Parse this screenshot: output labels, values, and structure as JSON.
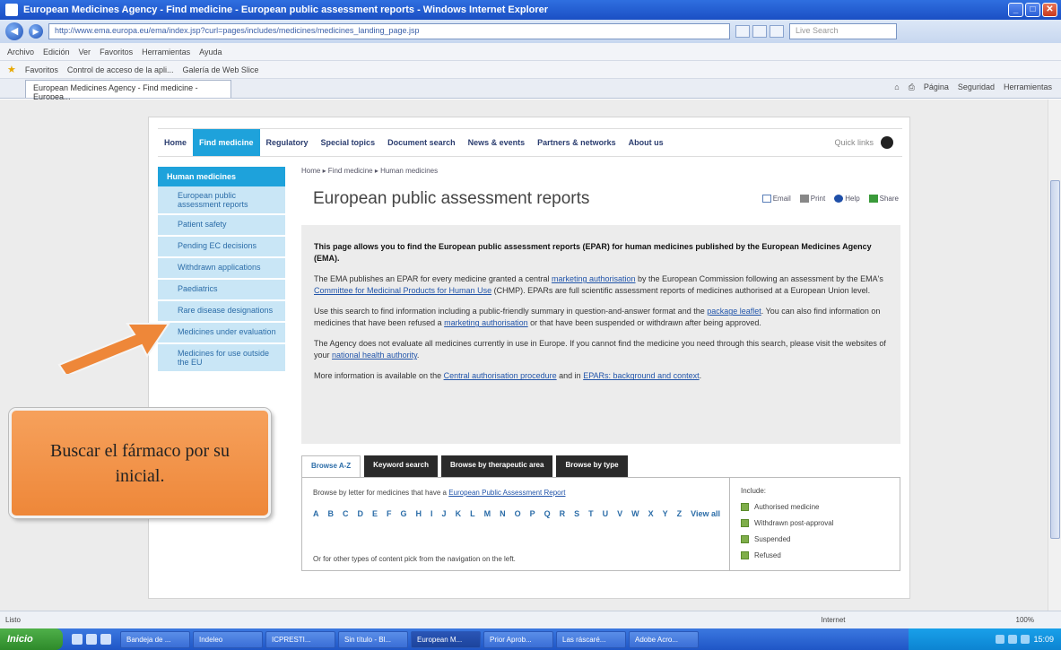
{
  "browser": {
    "title": "European Medicines Agency - Find medicine - European public assessment reports - Windows Internet Explorer",
    "url": "http://www.ema.europa.eu/ema/index.jsp?curl=pages/includes/medicines/medicines_landing_page.jsp",
    "search_placeholder": "Live Search",
    "menu": [
      "Archivo",
      "Edición",
      "Ver",
      "Favoritos",
      "Herramientas",
      "Ayuda"
    ],
    "favorites": [
      "Favoritos",
      "Control de acceso de la apli...",
      "Galería de Web Slice"
    ],
    "tab_label": "European Medicines Agency - Find medicine - Europea...",
    "cmd_tools": [
      "Página",
      "Seguridad",
      "Herramientas"
    ]
  },
  "site": {
    "nav": [
      "Home",
      "Find medicine",
      "Regulatory",
      "Special topics",
      "Document search",
      "News & events",
      "Partners & networks",
      "About us"
    ],
    "quick_links": "Quick links",
    "left_nav": {
      "header": "Human medicines",
      "items": [
        "European public assessment reports",
        "Patient safety",
        "Pending EC decisions",
        "Withdrawn applications",
        "Paediatrics",
        "Rare disease designations",
        "Medicines under evaluation",
        "Medicines for use outside the EU"
      ]
    },
    "breadcrumb": "Home ▸ Find medicine ▸ Human medicines",
    "page_title": "European public assessment reports",
    "page_tools": [
      "Email",
      "Print",
      "Help",
      "Share"
    ],
    "intro": {
      "p1": "This page allows you to find the European public assessment reports (EPAR) for human medicines published by the European Medicines Agency (EMA).",
      "p2a": "The EMA publishes an EPAR for every medicine granted a central ",
      "p2_link1": "marketing authorisation",
      "p2b": " by the European Commission following an assessment by the EMA's ",
      "p2_link2": "Committee for Medicinal Products for Human Use",
      "p2c": " (CHMP). EPARs are full scientific assessment reports of medicines authorised at a European Union level.",
      "p3a": "Use this search to find information including a public-friendly summary in question-and-answer format and the ",
      "p3_link1": "package leaflet",
      "p3b": ". You can also find information on medicines that have been refused a ",
      "p3_link2": "marketing authorisation",
      "p3c": " or that have been suspended or withdrawn after being approved.",
      "p4a": "The Agency does not evaluate all medicines currently in use in Europe. If you cannot find the medicine you need through this search, please visit the websites of your ",
      "p4_link": "national health authority",
      "p4b": ".",
      "p5a": "More information is available on the ",
      "p5_link1": "Central authorisation procedure",
      "p5b": " and in ",
      "p5_link2": "EPARs: background and context",
      "p5c": "."
    },
    "search_tabs": [
      "Browse A-Z",
      "Keyword search",
      "Browse by therapeutic area",
      "Browse by type"
    ],
    "browse": {
      "intro_text": "Browse by letter for medicines that have a ",
      "intro_link": "European Public Assessment Report",
      "letters": [
        "A",
        "B",
        "C",
        "D",
        "E",
        "F",
        "G",
        "H",
        "I",
        "J",
        "K",
        "L",
        "M",
        "N",
        "O",
        "P",
        "Q",
        "R",
        "S",
        "T",
        "U",
        "V",
        "W",
        "X",
        "Y",
        "Z"
      ],
      "view_all": "View all",
      "footer": "Or for other types of content pick from the navigation on the left."
    },
    "include": {
      "label": "Include:",
      "options": [
        "Authorised medicine",
        "Withdrawn post-approval",
        "Suspended",
        "Refused"
      ]
    }
  },
  "annotation": {
    "callout_text": "Buscar el fármaco por su inicial."
  },
  "status": {
    "left": "Listo",
    "zone": "Internet",
    "zoom": "100%"
  },
  "taskbar": {
    "start": "Inicio",
    "tasks": [
      "Bandeja de ...",
      "Indeleo",
      "ICPRESTI...",
      "Sin título - Bl...",
      "European M...",
      "Prior Aprob...",
      "Las ráscaré...",
      "Adobe Acro..."
    ],
    "clock": "15:09"
  },
  "colors": {
    "accent": "#1ea2db",
    "left_nav_bg": "#c9e6f6",
    "callout": "#ee8739",
    "link": "#2255aa"
  }
}
